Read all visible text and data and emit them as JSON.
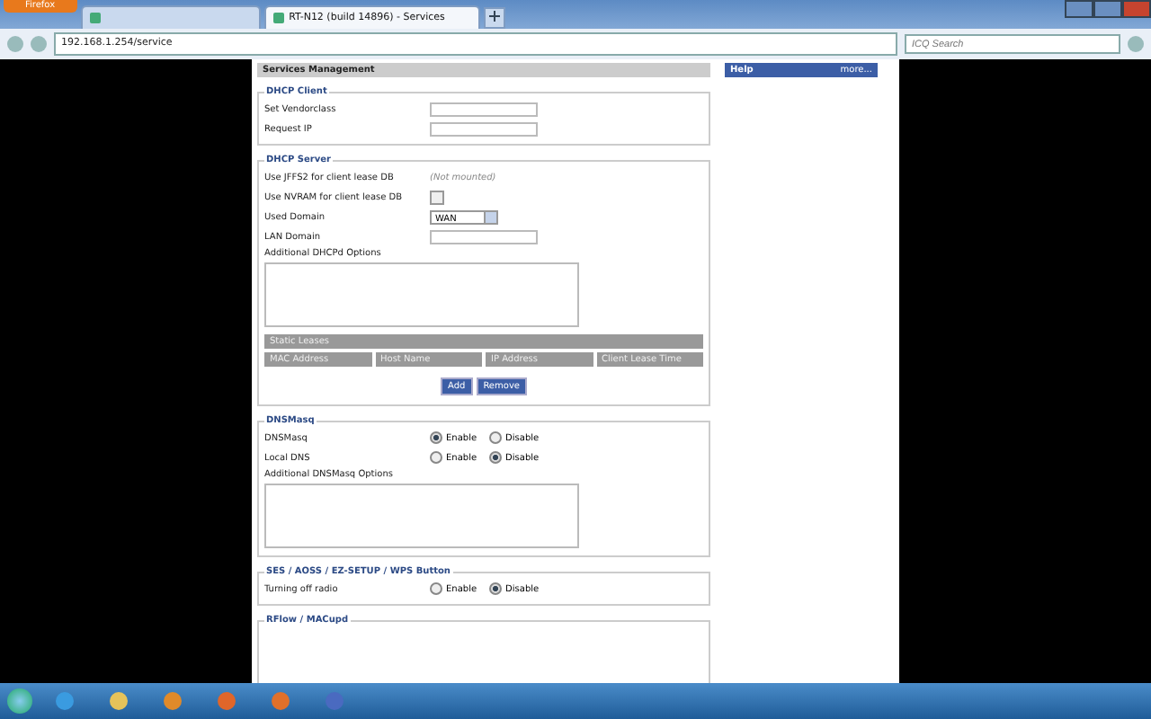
{
  "browser": {
    "menu_button": "Firefox",
    "tabs": [
      {
        "selected": false
      },
      {
        "label": "RT-N12 (build 14896) - Services",
        "selected": true
      }
    ],
    "url": "192.168.1.254/service",
    "search": {
      "placeholder": "ICQ Search"
    }
  },
  "page": {
    "title": "Services Management",
    "help": {
      "title": "Help",
      "more": "more..."
    },
    "sections": [
      {
        "title": "DHCP Client",
        "rows": [
          {
            "kind": "text",
            "label": "Set Vendorclass"
          },
          {
            "kind": "text",
            "label": "Request IP"
          }
        ]
      },
      {
        "title": "DHCP Server",
        "rows": [
          {
            "kind": "note",
            "label": "Use JFFS2 for client lease DB",
            "note": "(Not mounted)"
          },
          {
            "kind": "checkbox",
            "label": "Use NVRAM for client lease DB",
            "checked": false
          },
          {
            "kind": "select",
            "label": "Used Domain",
            "value": "WAN"
          },
          {
            "kind": "text",
            "label": "LAN Domain"
          },
          {
            "kind": "textarea",
            "label": "Additional DHCPd Options"
          },
          {
            "kind": "table",
            "title": "Static Leases",
            "columns": [
              "MAC Address",
              "Host Name",
              "IP Address",
              "Client Lease Time"
            ]
          },
          {
            "kind": "buttons",
            "buttons": [
              "Add",
              "Remove"
            ]
          }
        ]
      },
      {
        "title": "DNSMasq",
        "rows": [
          {
            "kind": "radio",
            "label": "DNSMasq",
            "options": [
              {
                "label": "Enable",
                "selected": true
              },
              {
                "label": "Disable",
                "selected": false
              }
            ]
          },
          {
            "kind": "radio",
            "label": "Local DNS",
            "options": [
              {
                "label": "Enable",
                "selected": false
              },
              {
                "label": "Disable",
                "selected": true
              }
            ]
          },
          {
            "kind": "textarea",
            "label": "Additional DNSMasq Options"
          }
        ]
      },
      {
        "title": "SES / AOSS / EZ-SETUP / WPS Button",
        "rows": [
          {
            "kind": "radio",
            "label": "Turning off radio",
            "options": [
              {
                "label": "Enable",
                "selected": false
              },
              {
                "label": "Disable",
                "selected": true
              }
            ]
          }
        ]
      },
      {
        "title": "RFlow / MACupd"
      }
    ]
  }
}
